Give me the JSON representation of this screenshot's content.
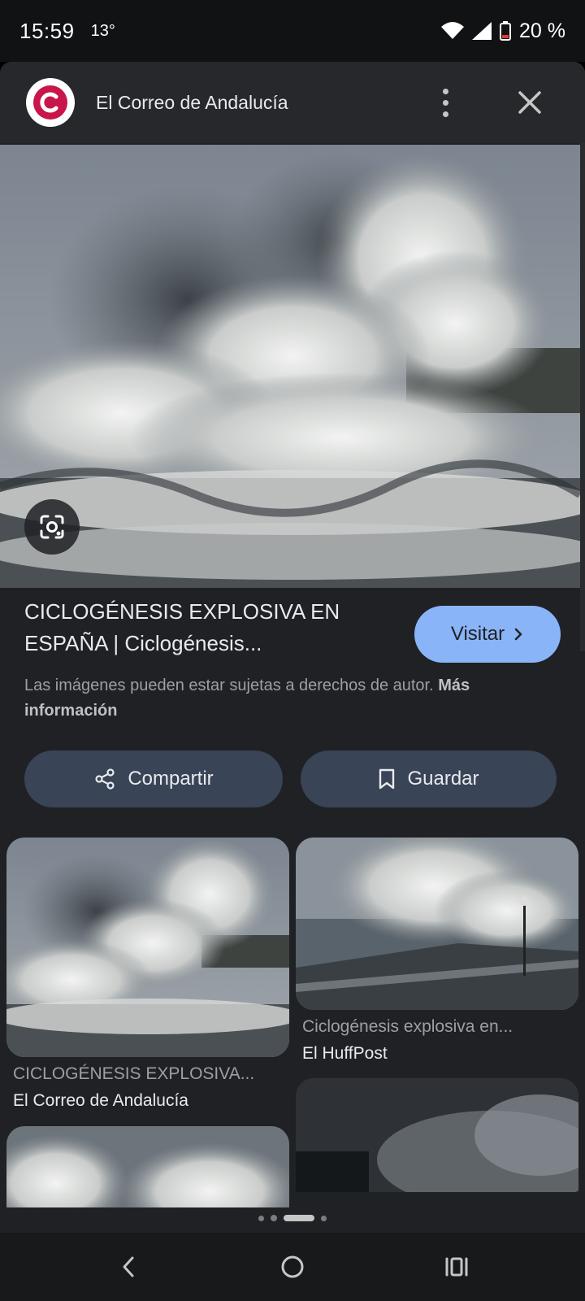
{
  "status_bar": {
    "time": "15:59",
    "temperature": "13°",
    "battery": "20 %"
  },
  "header": {
    "site_name": "El Correo de Andalucía",
    "logo_letter": "C",
    "logo_color": "#c8154a",
    "menu_icon": "more-vert-icon",
    "close_icon": "close-icon"
  },
  "main": {
    "image_description_icon": "lens-icon",
    "title_line1": "CICLOGÉNESIS EXPLOSIVA EN",
    "title_line2": "ESPAÑA | Ciclogénesis...",
    "visit_label": "Visitar",
    "copyright_text": "Las imágenes pueden estar sujetas a derechos de autor.",
    "more_info_label": "Más información",
    "share_label": "Compartir",
    "save_label": "Guardar",
    "accent_color": "#8ab4f8"
  },
  "related": [
    {
      "title": "CICLOGÉNESIS EXPLOSIVA...",
      "source": "El Correo de Andalucía"
    },
    {
      "title": "Ciclogénesis explosiva en...",
      "source": "El HuffPost"
    }
  ],
  "nav": {
    "back_icon": "back-icon",
    "home_icon": "home-icon",
    "recents_icon": "recents-icon"
  }
}
